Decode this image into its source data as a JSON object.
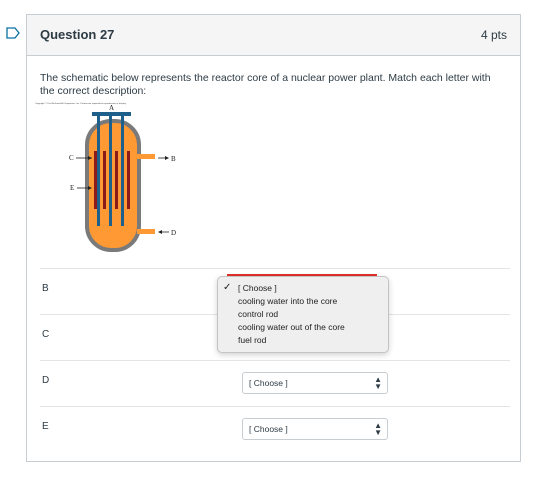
{
  "question": {
    "title": "Question 27",
    "points": "4 pts",
    "prompt": "The schematic below represents the reactor core of a nuclear power plant. Match each letter with the correct description:"
  },
  "diagram": {
    "copyright": "Copyright © The McGraw-Hill Companies, Inc. Permission required for reproduction or display.",
    "labels": {
      "a": "A",
      "b": "B",
      "c": "C",
      "d": "D",
      "e": "E"
    },
    "colors": {
      "vessel": "#ff9933",
      "vessel_border": "#7a7a7a",
      "top": "#1f5f8b",
      "rods": "#8b1a1a",
      "pipe": "#ff9933"
    }
  },
  "rows": [
    {
      "label": "B",
      "value": "[ Choose ]"
    },
    {
      "label": "C",
      "value": "[ Choose ]"
    },
    {
      "label": "D",
      "value": "[ Choose ]"
    },
    {
      "label": "E",
      "value": "[ Choose ]"
    }
  ],
  "dropdown": {
    "options": [
      "[ Choose ]",
      "cooling water into the core",
      "control rod",
      "cooling water out of the core",
      "fuel rod"
    ],
    "selected_index": 0
  }
}
